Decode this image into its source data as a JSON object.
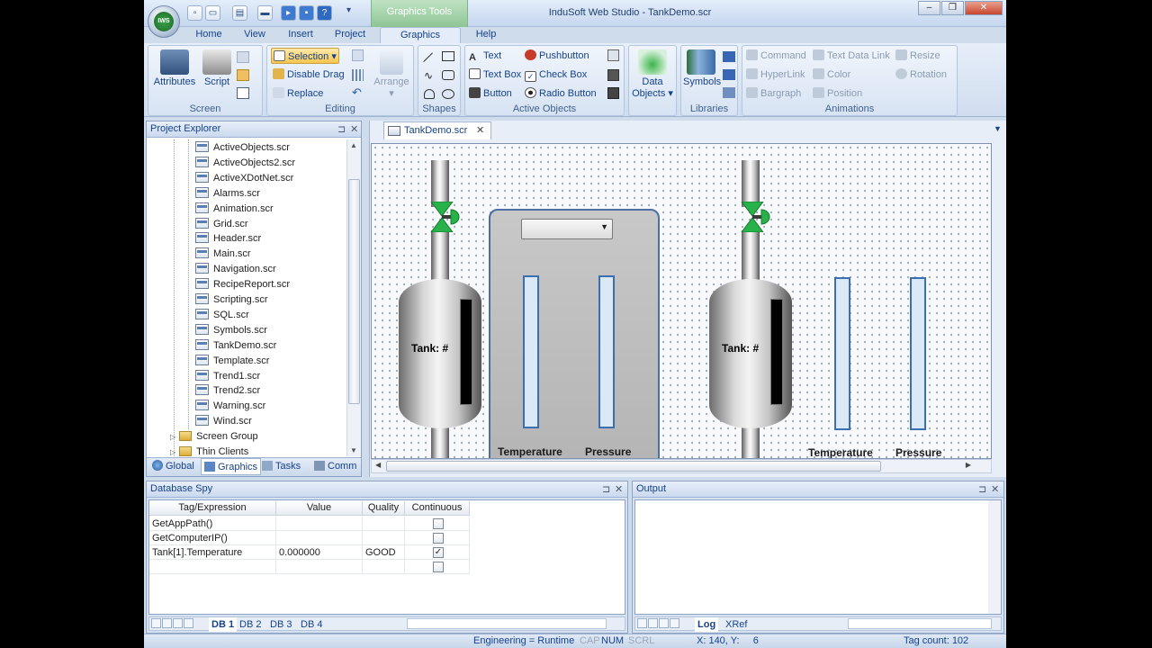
{
  "app": {
    "title": "InduSoft Web Studio - TankDemo.scr",
    "context_tab": "Graphics Tools",
    "logo": "IWS"
  },
  "ribbon_tabs": [
    "Home",
    "View",
    "Insert",
    "Project",
    "Graphics",
    "Help"
  ],
  "ribbon": {
    "screen": {
      "label": "Screen",
      "attributes": "Attributes",
      "script": "Script"
    },
    "editing": {
      "label": "Editing",
      "selection": "Selection",
      "disable_drag": "Disable Drag",
      "replace": "Replace",
      "arrange": "Arrange"
    },
    "shapes": {
      "label": "Shapes"
    },
    "active_objects": {
      "label": "Active Objects",
      "text": "Text",
      "text_box": "Text Box",
      "button": "Button",
      "pushbutton": "Pushbutton",
      "check_box": "Check Box",
      "radio_button": "Radio Button"
    },
    "data_objects": {
      "line1": "Data",
      "line2": "Objects"
    },
    "libraries": {
      "label": "Libraries",
      "symbols": "Symbols"
    },
    "animations": {
      "label": "Animations",
      "command": "Command",
      "hyperlink": "HyperLink",
      "bargraph": "Bargraph",
      "text_data_link": "Text Data Link",
      "color": "Color",
      "position": "Position",
      "resize": "Resize",
      "rotation": "Rotation"
    }
  },
  "explorer": {
    "title": "Project Explorer",
    "files": [
      "ActiveObjects.scr",
      "ActiveObjects2.scr",
      "ActiveXDotNet.scr",
      "Alarms.scr",
      "Animation.scr",
      "Grid.scr",
      "Header.scr",
      "Main.scr",
      "Navigation.scr",
      "RecipeReport.scr",
      "Scripting.scr",
      "SQL.scr",
      "Symbols.scr",
      "TankDemo.scr",
      "Template.scr",
      "Trend1.scr",
      "Trend2.scr",
      "Warning.scr",
      "Wind.scr"
    ],
    "folders": [
      "Screen Group",
      "Thin Clients"
    ],
    "tabs": [
      "Global",
      "Graphics",
      "Tasks",
      "Comm"
    ]
  },
  "document": {
    "tab": "TankDemo.scr",
    "tank_label": "Tank: #",
    "temperature": "Temperature",
    "pressure": "Pressure"
  },
  "database_spy": {
    "title": "Database Spy",
    "columns": [
      "Tag/Expression",
      "Value",
      "Quality",
      "Continuous"
    ],
    "rows": [
      {
        "tag": "GetAppPath()",
        "value": "",
        "quality": "",
        "continuous": false
      },
      {
        "tag": "GetComputerIP()",
        "value": "",
        "quality": "",
        "continuous": false
      },
      {
        "tag": "Tank[1].Temperature",
        "value": "0.000000",
        "quality": "GOOD",
        "continuous": true
      },
      {
        "tag": "",
        "value": "",
        "quality": "",
        "continuous": false
      }
    ],
    "tabs": [
      "DB 1",
      "DB 2",
      "DB 3",
      "DB 4"
    ]
  },
  "output": {
    "title": "Output",
    "tabs": [
      "Log",
      "XRef"
    ]
  },
  "status": {
    "mode": "Engineering = Runtime",
    "cap": "CAP",
    "num": "NUM",
    "scrl": "SCRL",
    "coords": "X: 140, Y:     6",
    "tag_count": "Tag count: 102"
  },
  "colors": {
    "accent": "#15428b",
    "ribbon": "#d0ddef",
    "valve": "#27b34a",
    "bar_border": "#3c6fb2"
  }
}
